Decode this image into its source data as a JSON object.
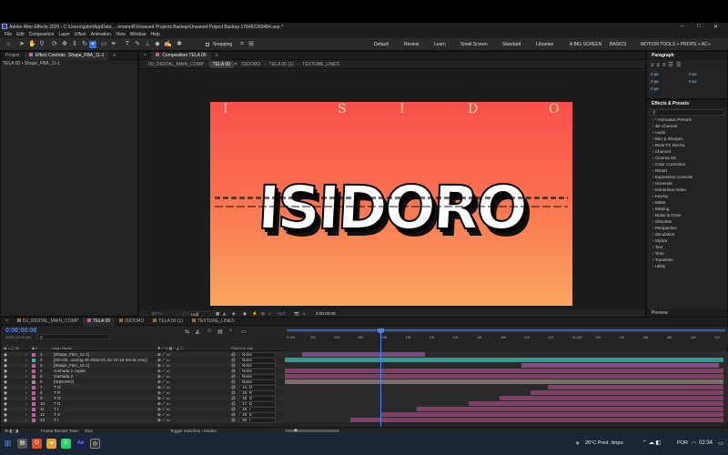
{
  "window": {
    "title": "Adobe After Effects 2025 - C:\\Users\\gabri\\AppData ... emannR\\Unsaved Projects Backup\\Unsaved Project Backup 178482283484.aep *",
    "minimize": "–",
    "maximize": "□",
    "close": "✕"
  },
  "menu": [
    "File",
    "Edit",
    "Composition",
    "Layer",
    "Effect",
    "Animation",
    "View",
    "Window",
    "Help"
  ],
  "toolbar": {
    "snapping_label": "Snapping",
    "workspaces": [
      "Default",
      "Review",
      "Learn",
      "Small Screen",
      "Standard",
      "Libraries",
      "A BIG SCREEN",
      "BASICS",
      "MOTION TOOLS + PROPS + AC"
    ],
    "more": "»"
  },
  "project_panel": {
    "tab_project": "Project",
    "tab_effect_controls": "Effect Controls",
    "effect_controls_target": "Shape_FBA_11-1",
    "breadcrumb": "TELA 00 • Shape_FBA_11-1"
  },
  "composition_panel": {
    "tab_title": "Composition TELA 00",
    "subtabs": [
      "ISI_DIGITAL_MAIN_COMP",
      "TELA 00",
      "ISIDORO",
      "TELA 00 (1)",
      "TEXTURE_LINES"
    ],
    "active_subtab": 1,
    "viewer_text": "ISIDORO",
    "top_letters": [
      "I",
      "S",
      "I",
      "D",
      "O"
    ],
    "zoom": "50 %",
    "resolution": "Half",
    "exposure": "+0,0",
    "timecode": "0:00:00:08"
  },
  "paragraph_panel": {
    "title": "Paragraph",
    "fields": [
      "0 px",
      "0 px",
      "0 px",
      "0 px",
      "0 px"
    ]
  },
  "effects_panel": {
    "title": "Effects & Presets",
    "search_placeholder": "",
    "items": [
      "* Animation Presets",
      "3D Channel",
      "Audio",
      "Blur & Sharpen",
      "Boris FX Mocha",
      "Channel",
      "Cinema 4D",
      "Color Correction",
      "Distort",
      "Expression Controls",
      "Generate",
      "Immersive Video",
      "Keying",
      "Matte",
      "Missing",
      "Noise & Grain",
      "Obsolete",
      "Perspective",
      "Simulation",
      "Stylize",
      "Text",
      "Time",
      "Transition",
      "Utility"
    ],
    "preview_label": "Preview"
  },
  "timeline": {
    "tabs": [
      "ISI_DIGITAL_MAIN_COMP",
      "TELA 00",
      "ISIDORO",
      "TELA 00 (1)",
      "TEXTURE_LINES"
    ],
    "active_tab": 1,
    "timecode": "0:00:00:08",
    "frame_info": "00008 (25.00 fps)",
    "search_placeholder": "",
    "col_layer_name": "Layer Name",
    "col_parent": "Parent & Link",
    "ruler_ticks": [
      "0:00f",
      "02f",
      "04f",
      "06f",
      "08f",
      "10f",
      "12f",
      "14f",
      "16f",
      "18f",
      "20f",
      "22f",
      "01:00f",
      "02f",
      "04f",
      "06f",
      "08f",
      "10f",
      "12f"
    ],
    "layers": [
      {
        "num": "1",
        "name": "[Shape_FBA_11-1]",
        "parent": "None",
        "color": "#c35fa3",
        "bar": "#7a4a86",
        "bar_start": 0.04,
        "bar_end": 0.32
      },
      {
        "num": "2",
        "name": "[4S-rob...oncing-4k-2022-01-22-18-16-39-utc.mov]",
        "parent": "None",
        "color": "#3fb3b3",
        "bar": "#2f9b95",
        "bar_start": 0.0,
        "bar_end": 1.0
      },
      {
        "num": "3",
        "name": "[Shape_FBA_11-1]",
        "parent": "None",
        "color": "#c35fa3",
        "bar": "#8a4a8e",
        "bar_start": 0.54,
        "bar_end": 0.99
      },
      {
        "num": "4",
        "name": "Camada 2 copiar",
        "parent": "None",
        "color": "#c35fa3",
        "bar": "#863c68",
        "bar_start": 0.0,
        "bar_end": 1.0
      },
      {
        "num": "5",
        "name": "Camada 2",
        "parent": "None",
        "color": "#c35fa3",
        "bar": "#863c68",
        "bar_start": 0.0,
        "bar_end": 1.0
      },
      {
        "num": "6",
        "name": "[ISIDORO]",
        "parent": "None",
        "color": "#8f8f8f",
        "bar": "#7d6e6a",
        "bar_start": 0.0,
        "bar_end": 1.0
      },
      {
        "num": "7",
        "name": "T   O",
        "parent": "14. O",
        "color": "#c35fa3",
        "bar": "#863c68",
        "bar_start": 0.6,
        "bar_end": 1.0
      },
      {
        "num": "8",
        "name": "T   R",
        "parent": "15. R",
        "color": "#c35fa3",
        "bar": "#863c68",
        "bar_start": 0.56,
        "bar_end": 1.0
      },
      {
        "num": "9",
        "name": "T   O",
        "parent": "16. O",
        "color": "#c35fa3",
        "bar": "#863c68",
        "bar_start": 0.49,
        "bar_end": 1.0
      },
      {
        "num": "10",
        "name": "T   D",
        "parent": "17. D",
        "color": "#c35fa3",
        "bar": "#863c68",
        "bar_start": 0.42,
        "bar_end": 1.0
      },
      {
        "num": "11",
        "name": "T   I",
        "parent": "18. I",
        "color": "#c35fa3",
        "bar": "#863c68",
        "bar_start": 0.3,
        "bar_end": 1.0
      },
      {
        "num": "12",
        "name": "T   S",
        "parent": "19. S",
        "color": "#c35fa3",
        "bar": "#863c68",
        "bar_start": 0.22,
        "bar_end": 1.0
      },
      {
        "num": "13",
        "name": "T   I",
        "parent": "20. I",
        "color": "#c35fa3",
        "bar": "#863c68",
        "bar_start": 0.15,
        "bar_end": 1.0
      }
    ],
    "frame_render_label": "Frame Render Time:",
    "frame_render_value": "0ms",
    "toggle_label": "Toggle Switches / Modes"
  },
  "taskbar": {
    "weather": "20°C  Pred. limpo",
    "lang": "POR",
    "time": "02:34"
  }
}
